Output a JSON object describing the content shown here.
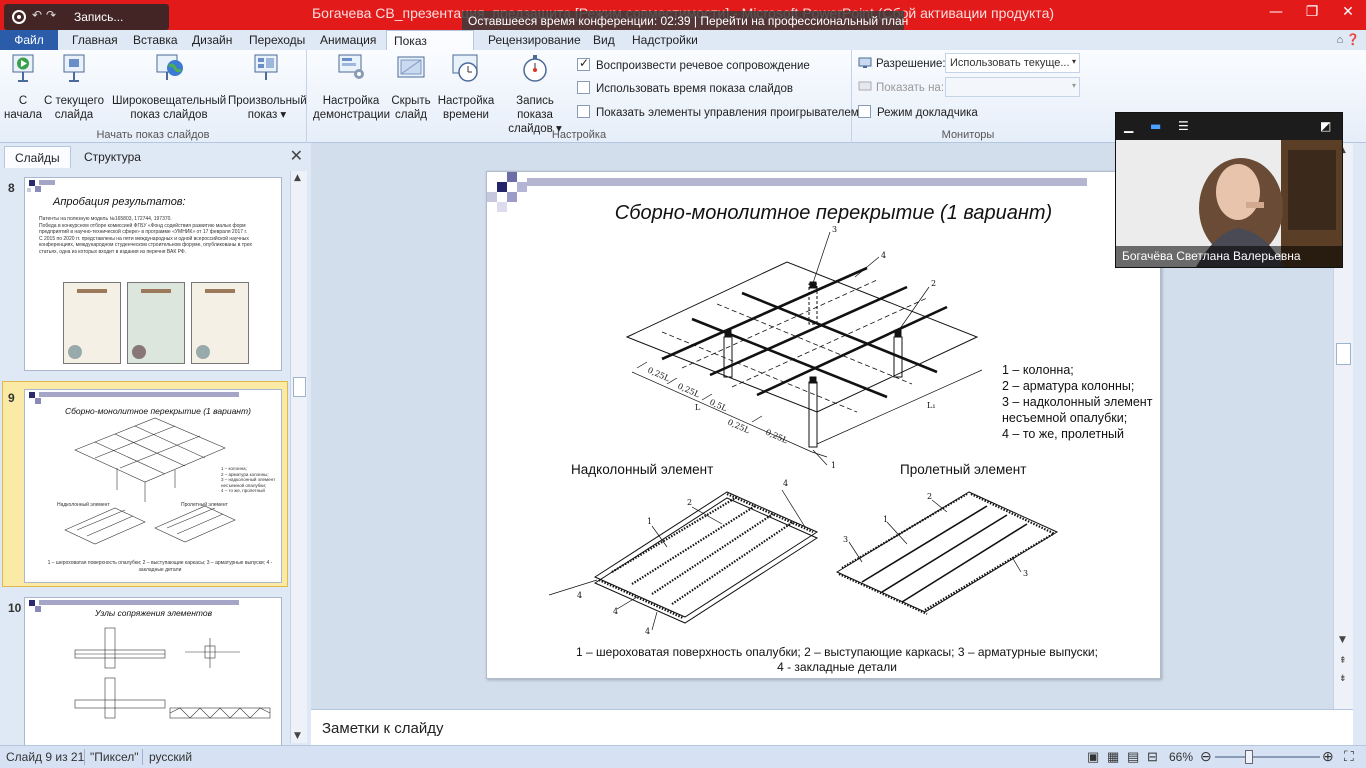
{
  "titlebar": {
    "title": "Богачева СВ_презентация_предзащита [Режим совместимости] - Microsoft PowerPoint (Сбой активации продукта)",
    "recording_label": "Запись...",
    "conference_banner": "Оставшееся время конференции: 02:39 | Перейти на профессиональный план"
  },
  "tabs": {
    "file": "Файл",
    "items": [
      "Главная",
      "Вставка",
      "Дизайн",
      "Переходы",
      "Анимация",
      "Показ слайдов",
      "Рецензирование",
      "Вид",
      "Надстройки"
    ],
    "active": "Показ слайдов"
  },
  "ribbon": {
    "group_start": {
      "label": "Начать показ слайдов",
      "btn_from_start": [
        "С",
        "начала"
      ],
      "btn_from_current": [
        "С текущего",
        "слайда"
      ],
      "btn_broadcast": [
        "Широковещательный",
        "показ слайдов"
      ],
      "btn_custom": [
        "Произвольный",
        "показ ▾"
      ]
    },
    "group_setup": {
      "label": "Настройка",
      "btn_setup": [
        "Настройка",
        "демонстрации"
      ],
      "btn_hide": [
        "Скрыть",
        "слайд"
      ],
      "btn_rehearse": [
        "Настройка",
        "времени"
      ],
      "btn_record": [
        "Запись показа",
        "слайдов ▾"
      ],
      "check_narration": "Воспроизвести речевое сопровождение",
      "check_timings": "Использовать время показа слайдов",
      "check_controls": "Показать элементы управления проигрывателем"
    },
    "group_monitors": {
      "label": "Мониторы",
      "resolution_label": "Разрешение:",
      "resolution_value": "Использовать текуще...",
      "show_on_label": "Показать на:",
      "presenter_view": "Режим докладчика"
    }
  },
  "leftpane": {
    "tab_slides": "Слайды",
    "tab_outline": "Структура",
    "slides": [
      {
        "num": "8",
        "title": "Апробация результатов:",
        "bullets": [
          "Патенты на полезную модель №165803, 172744, 197370.",
          "Победа в конкурсном отборе комиссией ФГБУ «Фонд содействия развитию малых форм предприятий в научно-технической сфере» в программе «УМНИК» от 17 февраля 2017 г.",
          "С 2015 по 2020 гг. представлены на пяти международных и одной всероссийской научных конференциях, международном студенческом строительном форуме, опубликованы в трех статьях, одна из которых входит в издания из перечня ВАК РФ."
        ]
      },
      {
        "num": "9",
        "title": "Сборно-монолитное перекрытие (1 вариант)",
        "legend": [
          "1 – колонна;",
          "2 – арматура колонны;",
          "3 – надколонный элемент",
          "несъемной опалубки;",
          "4 – то же, пролетный"
        ],
        "sub_left": "Надколонный элемент",
        "sub_right": "Пролетный элемент",
        "caption": "1 – шероховатая поверхность опалубки; 2 – выступающие каркасы; 3 – арматурные выпуски; 4 - закладные детали"
      },
      {
        "num": "10",
        "title": "Узлы сопряжения элементов"
      }
    ]
  },
  "slide": {
    "title": "Сборно-монолитное перекрытие (1 вариант)",
    "legend": [
      "1 – колонна;",
      "2 – арматура колонны;",
      "3 – надколонный элемент",
      "несъемной опалубки;",
      "4 – то же, пролетный"
    ],
    "sub_left": "Надколонный элемент",
    "sub_right": "Пролетный элемент",
    "caption_line1": "1 – шероховатая поверхность опалубки; 2 – выступающие каркасы; 3 – арматурные выпуски;",
    "caption_line2": "4 - закладные детали",
    "drawing_labels": {
      "callouts_top": [
        "3",
        "4",
        "2",
        "1"
      ],
      "dims": [
        "0,25L",
        "0,25L",
        "0,5L",
        "0,25L",
        "0,25L",
        "L",
        "L₁"
      ],
      "callouts_left": [
        "1",
        "2",
        "4",
        "4",
        "4",
        "4"
      ],
      "callouts_right": [
        "2",
        "1",
        "3",
        "3"
      ]
    }
  },
  "notes": {
    "placeholder": "Заметки к слайду"
  },
  "status": {
    "slide_pos": "Слайд 9 из 21",
    "theme": "\"Пиксел\"",
    "language": "русский",
    "zoom": "66%"
  },
  "video": {
    "participant": "Богачёва Светлана Валерьевна"
  },
  "colors": {
    "titlebar": "#e21a1a",
    "file_tab": "#2a5caa",
    "selected_thumb": "#fbe9a6"
  }
}
